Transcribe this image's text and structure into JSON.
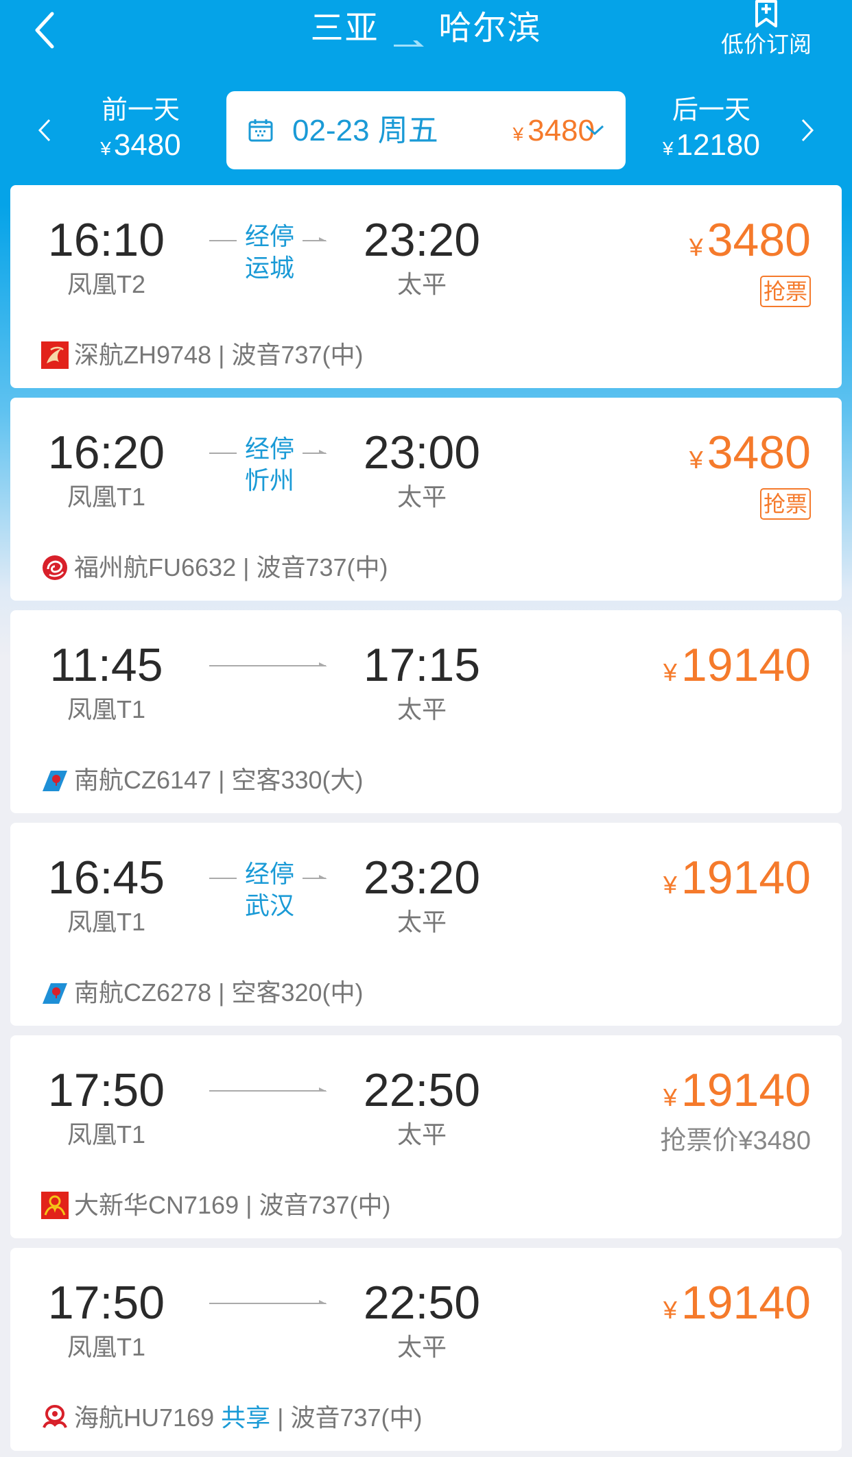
{
  "header": {
    "origin": "三亚",
    "destination": "哈尔滨",
    "subscribe_label": "低价订阅",
    "icons": {
      "back": "chevron-left-icon",
      "route_arrow": "arrow-right-icon",
      "subscribe": "bookmark-plus-icon"
    }
  },
  "date_nav": {
    "prev": {
      "label": "前一天",
      "currency": "¥",
      "price": "3480"
    },
    "current": {
      "date": "02-23 周五",
      "currency": "¥",
      "price": "3480"
    },
    "next": {
      "label": "后一天",
      "currency": "¥",
      "price": "12180"
    },
    "icons": {
      "prev": "chevron-left-icon",
      "next": "chevron-right-icon",
      "calendar": "calendar-icon",
      "dropdown": "chevron-down-icon"
    }
  },
  "colors": {
    "brand_blue": "#05a3e8",
    "accent_blue": "#1a9ad6",
    "price_orange": "#f57a2b"
  },
  "flights": [
    {
      "dep_time": "16:10",
      "dep_airport": "凤凰T2",
      "arr_time": "23:20",
      "arr_airport": "太平",
      "stop_label": "经停",
      "stop_city": "运城",
      "currency": "¥",
      "price": "3480",
      "grab_label": "抢票",
      "airline": "深航",
      "flight_no": "ZH9748",
      "aircraft": "波音737(中)",
      "logo": "shenzhen-airlines-logo-icon"
    },
    {
      "dep_time": "16:20",
      "dep_airport": "凤凰T1",
      "arr_time": "23:00",
      "arr_airport": "太平",
      "stop_label": "经停",
      "stop_city": "忻州",
      "currency": "¥",
      "price": "3480",
      "grab_label": "抢票",
      "airline": "福州航",
      "flight_no": "FU6632",
      "aircraft": "波音737(中)",
      "logo": "fuzhou-airlines-logo-icon"
    },
    {
      "dep_time": "11:45",
      "dep_airport": "凤凰T1",
      "arr_time": "17:15",
      "arr_airport": "太平",
      "currency": "¥",
      "price": "19140",
      "airline": "南航",
      "flight_no": "CZ6147",
      "aircraft": "空客330(大)",
      "logo": "china-southern-logo-icon"
    },
    {
      "dep_time": "16:45",
      "dep_airport": "凤凰T1",
      "arr_time": "23:20",
      "arr_airport": "太平",
      "stop_label": "经停",
      "stop_city": "武汉",
      "currency": "¥",
      "price": "19140",
      "airline": "南航",
      "flight_no": "CZ6278",
      "aircraft": "空客320(中)",
      "logo": "china-southern-logo-icon"
    },
    {
      "dep_time": "17:50",
      "dep_airport": "凤凰T1",
      "arr_time": "22:50",
      "arr_airport": "太平",
      "currency": "¥",
      "price": "19140",
      "grab_price": "抢票价¥3480",
      "airline": "大新华",
      "flight_no": "CN7169",
      "aircraft": "波音737(中)",
      "logo": "grand-china-air-logo-icon"
    },
    {
      "dep_time": "17:50",
      "dep_airport": "凤凰T1",
      "arr_time": "22:50",
      "arr_airport": "太平",
      "currency": "¥",
      "price": "19140",
      "airline": "海航",
      "flight_no": "HU7169",
      "share_label": "共享",
      "aircraft": "波音737(中)",
      "logo": "hainan-airlines-logo-icon"
    }
  ]
}
